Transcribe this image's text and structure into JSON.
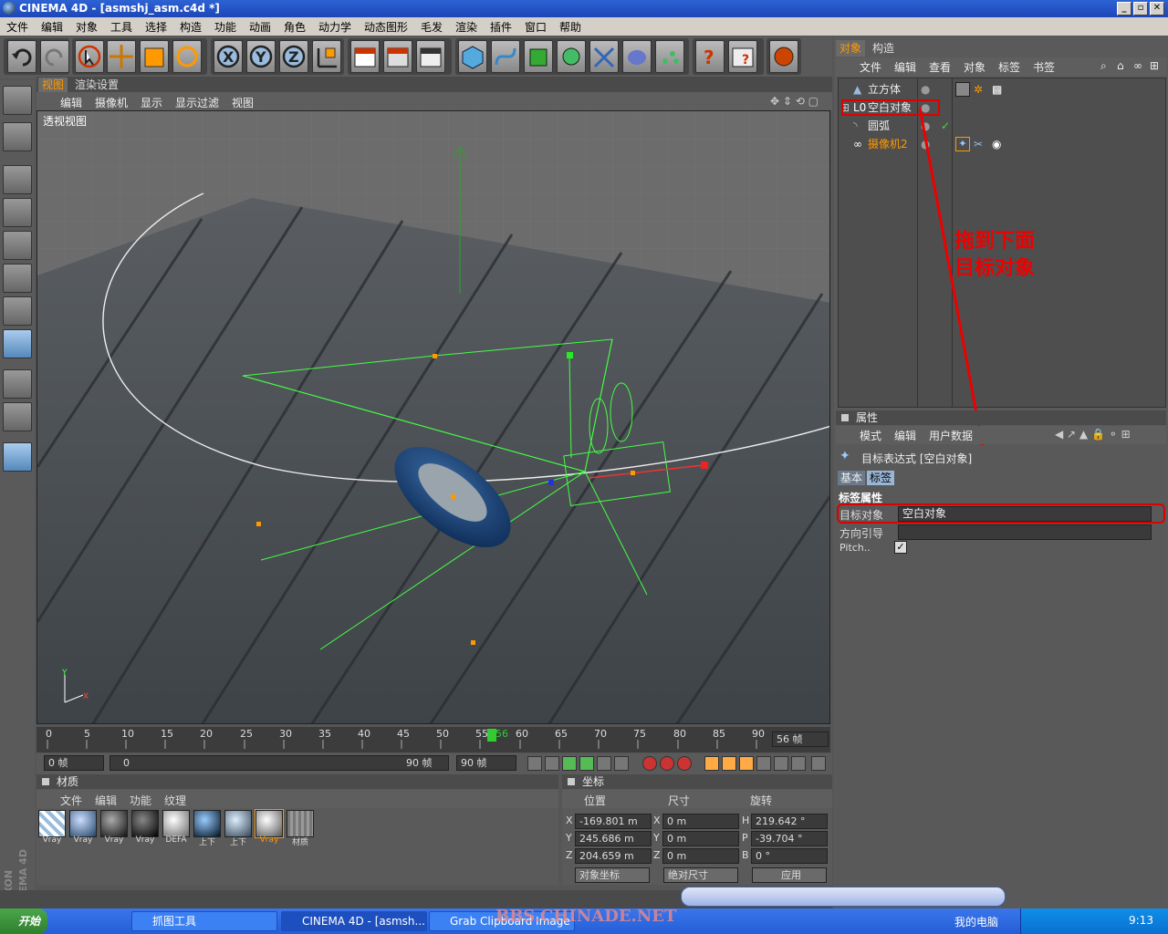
{
  "window": {
    "title": "CINEMA 4D - [asmshj_asm.c4d *]"
  },
  "menubar": [
    "文件",
    "编辑",
    "对象",
    "工具",
    "选择",
    "构造",
    "功能",
    "动画",
    "角色",
    "动力学",
    "动态图形",
    "毛发",
    "渲染",
    "插件",
    "窗口",
    "帮助"
  ],
  "viewport": {
    "tabs": [
      "视图",
      "渲染设置"
    ],
    "menu": [
      "编辑",
      "摄像机",
      "显示",
      "显示过滤",
      "视图"
    ],
    "label": "透视视图"
  },
  "timeline": {
    "ticks": [
      "0",
      "5",
      "10",
      "15",
      "20",
      "25",
      "30",
      "35",
      "40",
      "45",
      "50",
      "55",
      "56",
      "60",
      "65",
      "70",
      "75",
      "80",
      "85",
      "90"
    ],
    "current": "56 帧",
    "start": "0 帧",
    "range_start": "0",
    "range_end": "90 帧",
    "range_end2": "90 帧"
  },
  "materials": {
    "title": "材质",
    "menu": [
      "文件",
      "编辑",
      "功能",
      "纹理"
    ],
    "items": [
      "Vray",
      "Vray",
      "Vray",
      "Vray",
      "DEFA",
      "上下",
      "上下",
      "Vray",
      "材质"
    ]
  },
  "coords": {
    "title": "坐标",
    "headers": [
      "位置",
      "尺寸",
      "旋转"
    ],
    "rows": [
      {
        "axis": "X",
        "pos": "-169.801 m",
        "saxis": "X",
        "size": "0 m",
        "raxis": "H",
        "rot": "219.642 °"
      },
      {
        "axis": "Y",
        "pos": "245.686 m",
        "saxis": "Y",
        "size": "0 m",
        "raxis": "P",
        "rot": "-39.704 °"
      },
      {
        "axis": "Z",
        "pos": "204.659 m",
        "saxis": "Z",
        "size": "0 m",
        "raxis": "B",
        "rot": "0 °"
      }
    ],
    "mode": "对象坐标",
    "size_mode": "绝对尺寸",
    "apply": "应用"
  },
  "objects": {
    "tabs": [
      "对象",
      "构造"
    ],
    "menu": [
      "文件",
      "编辑",
      "查看",
      "对象",
      "标签",
      "书签"
    ],
    "items": [
      {
        "name": "立方体"
      },
      {
        "name": "空白对象"
      },
      {
        "name": "圆弧"
      },
      {
        "name": "摄像机2"
      }
    ]
  },
  "attributes": {
    "title": "属性",
    "menu": [
      "模式",
      "编辑",
      "用户数据"
    ],
    "object": "目标表达式 [空白对象]",
    "tabs": [
      "基本",
      "标签"
    ],
    "section": "标签属性",
    "fields": [
      {
        "label": "目标对象",
        "value": "空白对象"
      },
      {
        "label": "方向引导",
        "value": ""
      },
      {
        "label": "Pitch..",
        "value": "✓"
      }
    ]
  },
  "annotation": {
    "line1": "拖到下面",
    "line2": "目标对象"
  },
  "taskbar": {
    "start": "开始",
    "tasks": [
      "抓图工具",
      "CINEMA 4D - [asmsh...",
      "Grab Clipboard Image"
    ],
    "mycomputer": "我的电脑",
    "clock": "9:13"
  },
  "watermark": "BBS.CHINADE.NET",
  "colors": {
    "accent": "#ff9900",
    "annotation": "#ee0000",
    "title_blue": "#1c46b8"
  }
}
